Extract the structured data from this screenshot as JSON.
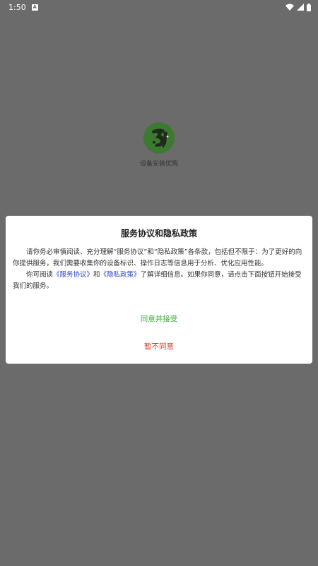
{
  "status_bar": {
    "time": "1:50",
    "notification_badge": "A",
    "icons": [
      "wifi-icon",
      "signal-icon",
      "battery-icon"
    ]
  },
  "app": {
    "name": "设备安装优购",
    "logo_color": "#3b7a30"
  },
  "dialog": {
    "title": "服务协议和隐私政策",
    "paragraph1": "请你务必审慎阅读、充分理解“服务协议”和“隐私政策”各条款，包括但不限于：为了更好的向你提供服务，我们需要收集你的设备标识、操作日志等信息用于分析、优化应用性能。",
    "paragraph2_prefix": "你可阅读",
    "service_link": "《服务协议》",
    "connector": "和",
    "privacy_link": "《隐私政策》",
    "paragraph2_suffix": "了解详细信息。如果你同意，请点击下面按钮开始接受我们的服务。",
    "accept_label": "同意并接受",
    "reject_label": "暂不同意"
  },
  "colors": {
    "overlay": "#6b6b6b",
    "accept": "#3fa63b",
    "reject": "#d93a2b",
    "link": "#2b44c8"
  }
}
